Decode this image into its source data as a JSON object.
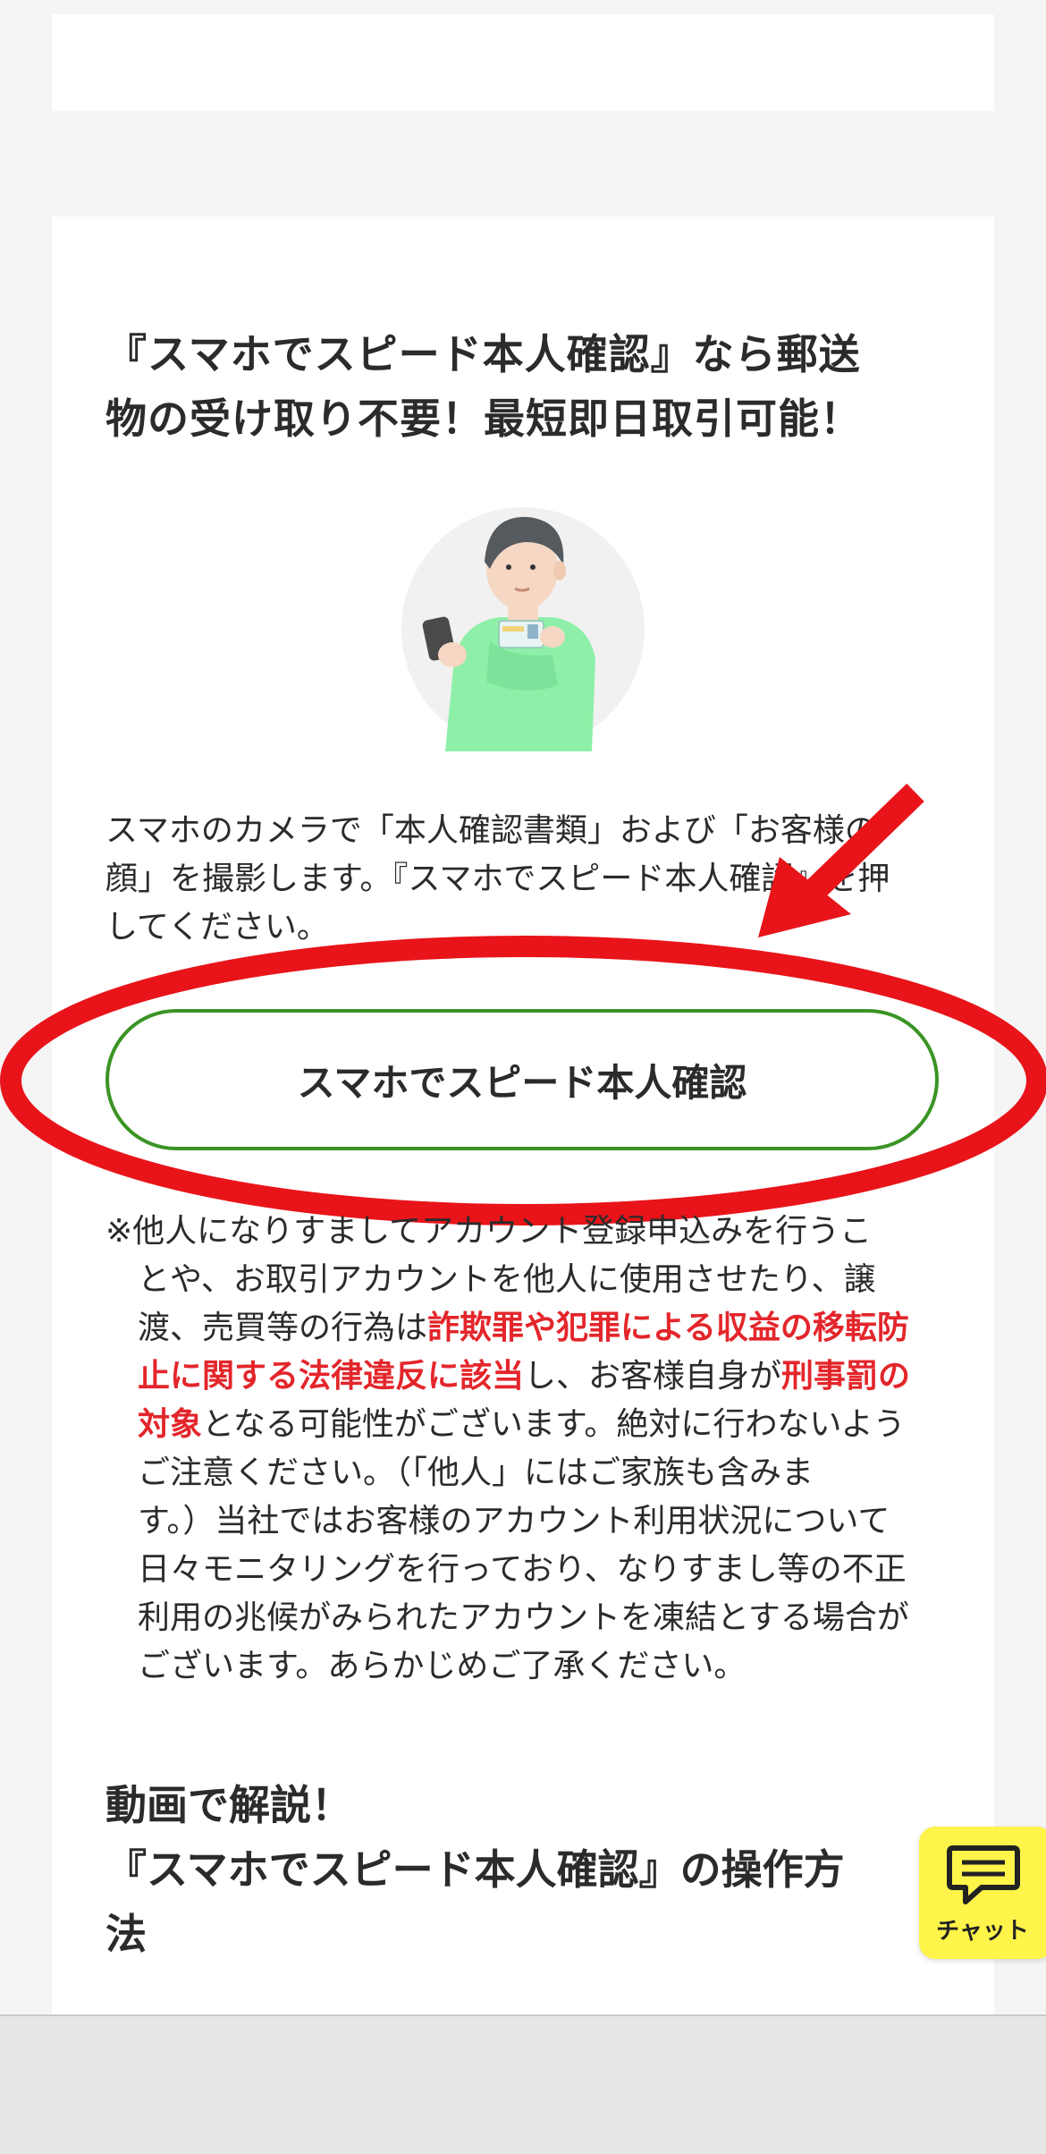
{
  "section": {
    "heading_lines": [
      "『スマホでスピード本人確認』なら郵送",
      "物の受け取り不要！最短即日取引可能！"
    ],
    "description_lines": [
      "スマホのカメラで「本人確認書類」および「お客様の",
      "顔」を撮影します。『スマホでスピード本人確認』を押",
      "してください。"
    ],
    "cta_label": "スマホでスピード本人確認"
  },
  "notice": {
    "l1": "※他人になりすましてアカウント登録申込みを行うこ",
    "l2": "とや、お取引アカウントを他人に使用させたり、譲",
    "l3_a": "渡、売買等の行為は",
    "l3_b": "詐欺罪や犯罪による収益の移転防",
    "l4_a": "止に関する法律違反に該当",
    "l4_b": "し、お客様自身が",
    "l4_c": "刑事罰の",
    "l5_a": "対象",
    "l5_b": "となる可能性がございます。絶対に行わないよう",
    "l6": "ご注意ください。（「他人」にはご家族も含みま",
    "l7": "す。）当社ではお客様のアカウント利用状況について",
    "l8": "日々モニタリングを行っており、なりすまし等の不正",
    "l9": "利用の兆候がみられたアカウントを凍結とする場合が",
    "l10": "ございます。あらかじめご了承ください。"
  },
  "video": {
    "heading_lines": [
      "動画で解説！",
      "『スマホでスピード本人確認』の操作方",
      "法"
    ]
  },
  "chat": {
    "label": "チャット",
    "icon": "chat-bubble-icon"
  },
  "colors": {
    "accent_green": "#3a9424",
    "warning_red": "#e3262b",
    "annotation_red": "#e8141a",
    "chat_yellow": "#fff44a"
  }
}
